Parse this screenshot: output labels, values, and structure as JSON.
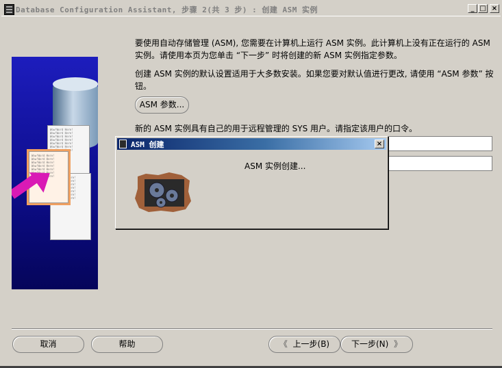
{
  "window": {
    "title": "Database Configuration Assistant, 步骤 2(共 3 步) : 创建 ASM 实例",
    "controls": {
      "minimize": "_",
      "maximize": "□",
      "close": "×"
    }
  },
  "content": {
    "paragraph1": "要使用自动存储管理 (ASM), 您需要在计算机上运行 ASM 实例。此计算机上没有正在运行的 ASM 实例。请使用本页为您单击 “下一步” 时将创建的新 ASM 实例指定参数。",
    "paragraph2": "创建 ASM 实例的默认设置适用于大多数安装。如果您要对默认值进行更改, 请使用 “ASM 参数” 按钮。",
    "asm_params_button": "ASM 参数...",
    "paragraph3": "新的 ASM 实例具有自己的用于远程管理的 SYS 用户。请指定该用户的口令。"
  },
  "footer": {
    "cancel": "取消",
    "help": "帮助",
    "back": "上一步(B)",
    "next": "下一步(N)",
    "back_chevron": "《",
    "next_chevron": "》"
  },
  "dialog": {
    "title": "ASM 创建",
    "close": "×",
    "message": "ASM 实例创建..."
  },
  "hero": {
    "paper_text": "Wow!Word Here! Wow!Word Here! Wow!Word Here! Wow!Word Here! Wow!Word Here! Wow!Word Here! Wow!Word Here!"
  },
  "colors": {
    "window_bg": "#d4d0c8",
    "dialog_title_start": "#0a246a",
    "dialog_title_end": "#a6caf0",
    "hero_blue": "#1d1dbd",
    "arrow_magenta": "#d91ab5"
  }
}
